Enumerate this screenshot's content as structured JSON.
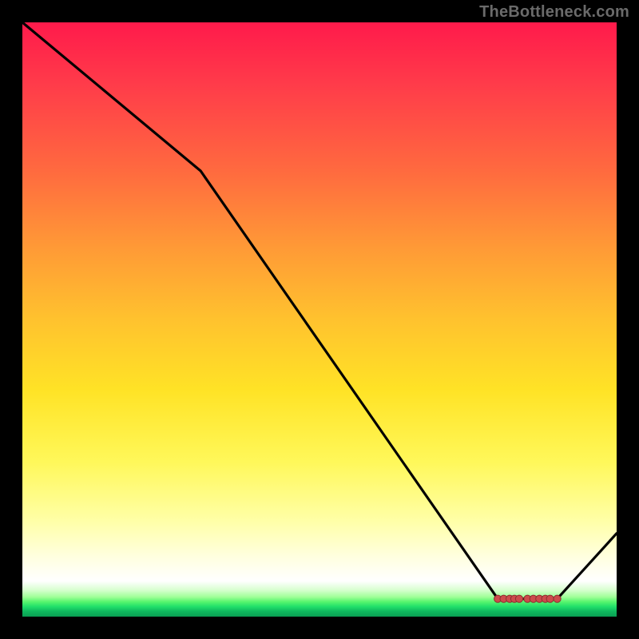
{
  "watermark": "TheBottleneck.com",
  "colors": {
    "line": "#000000",
    "marker_fill": "#cc4b4b",
    "marker_stroke": "#8a2f2f"
  },
  "chart_data": {
    "type": "line",
    "title": "",
    "xlabel": "",
    "ylabel": "",
    "xlim": [
      0,
      100
    ],
    "ylim": [
      0,
      100
    ],
    "line_points": [
      {
        "x": 0,
        "y": 100
      },
      {
        "x": 30,
        "y": 75
      },
      {
        "x": 80,
        "y": 3
      },
      {
        "x": 90,
        "y": 3
      },
      {
        "x": 100,
        "y": 14
      }
    ],
    "markers": [
      {
        "x": 80,
        "y": 3
      },
      {
        "x": 81,
        "y": 3
      },
      {
        "x": 82,
        "y": 3
      },
      {
        "x": 82.8,
        "y": 3
      },
      {
        "x": 83.6,
        "y": 3
      },
      {
        "x": 85,
        "y": 3
      },
      {
        "x": 86,
        "y": 3
      },
      {
        "x": 87,
        "y": 3
      },
      {
        "x": 88,
        "y": 3
      },
      {
        "x": 88.8,
        "y": 3
      },
      {
        "x": 90,
        "y": 3
      }
    ],
    "grid": false,
    "legend": false
  }
}
